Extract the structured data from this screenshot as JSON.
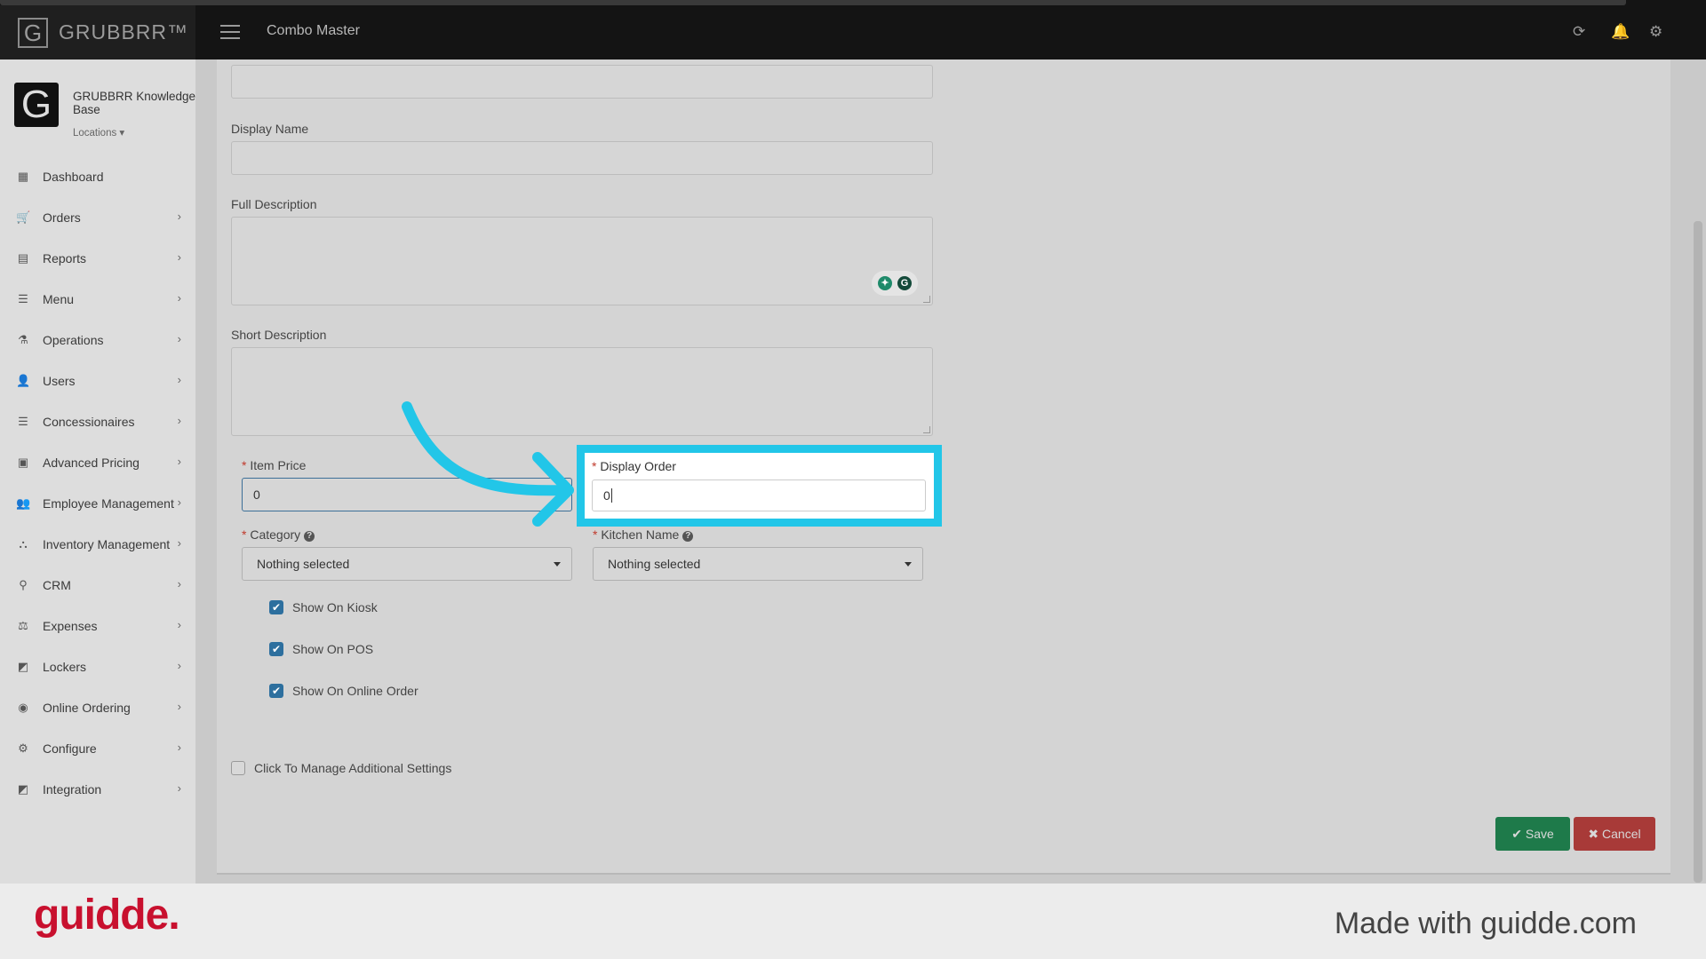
{
  "app": {
    "logo_letter": "G",
    "brand": "GRUBBRR™",
    "page_title": "Combo Master"
  },
  "profile": {
    "avatar_letter": "G",
    "name": "GRUBBRR Knowledge Base",
    "locations": "Locations ▾"
  },
  "sidebar": {
    "items": [
      {
        "label": "Dashboard",
        "icon": "▦"
      },
      {
        "label": "Orders",
        "icon": "🛒"
      },
      {
        "label": "Reports",
        "icon": "▤"
      },
      {
        "label": "Menu",
        "icon": "☰"
      },
      {
        "label": "Operations",
        "icon": "⚗"
      },
      {
        "label": "Users",
        "icon": "👤"
      },
      {
        "label": "Concessionaires",
        "icon": "☰"
      },
      {
        "label": "Advanced Pricing",
        "icon": "▣"
      },
      {
        "label": "Employee Management",
        "icon": "👥"
      },
      {
        "label": "Inventory Management",
        "icon": "⛬"
      },
      {
        "label": "CRM",
        "icon": "⚲"
      },
      {
        "label": "Expenses",
        "icon": "⚖"
      },
      {
        "label": "Lockers",
        "icon": "◩"
      },
      {
        "label": "Online Ordering",
        "icon": "◉"
      },
      {
        "label": "Configure",
        "icon": "⚙"
      },
      {
        "label": "Integration",
        "icon": "◩"
      }
    ],
    "chevron": "›"
  },
  "form": {
    "display_name_label": "Display Name",
    "full_description_label": "Full Description",
    "short_description_label": "Short Description",
    "required_mark": "*",
    "item_price_label": "Item Price",
    "item_price_value": "0",
    "display_order_label": "Display Order",
    "display_order_value": "0",
    "category_label": "Category",
    "category_value": "Nothing selected",
    "kitchen_name_label": "Kitchen Name",
    "kitchen_name_value": "Nothing selected",
    "help_mark": "?",
    "checkboxes": [
      {
        "label": "Show On Kiosk",
        "checked": true
      },
      {
        "label": "Show On POS",
        "checked": true
      },
      {
        "label": "Show On Online Order",
        "checked": true
      }
    ],
    "additional_settings_label": "Click To Manage Additional Settings",
    "additional_settings_checked": false,
    "grammarly_left": "✦",
    "grammarly_right": "G"
  },
  "actions": {
    "save_label": "✔ Save",
    "cancel_label": "✖ Cancel",
    "save_color": "#1e7a4a",
    "cancel_color": "#a83a38"
  },
  "footer": {
    "brand": "guidde.",
    "made_with": "Made with guidde.com"
  },
  "colors": {
    "highlight": "#22c6e8",
    "arrow": "#22c6e8"
  }
}
